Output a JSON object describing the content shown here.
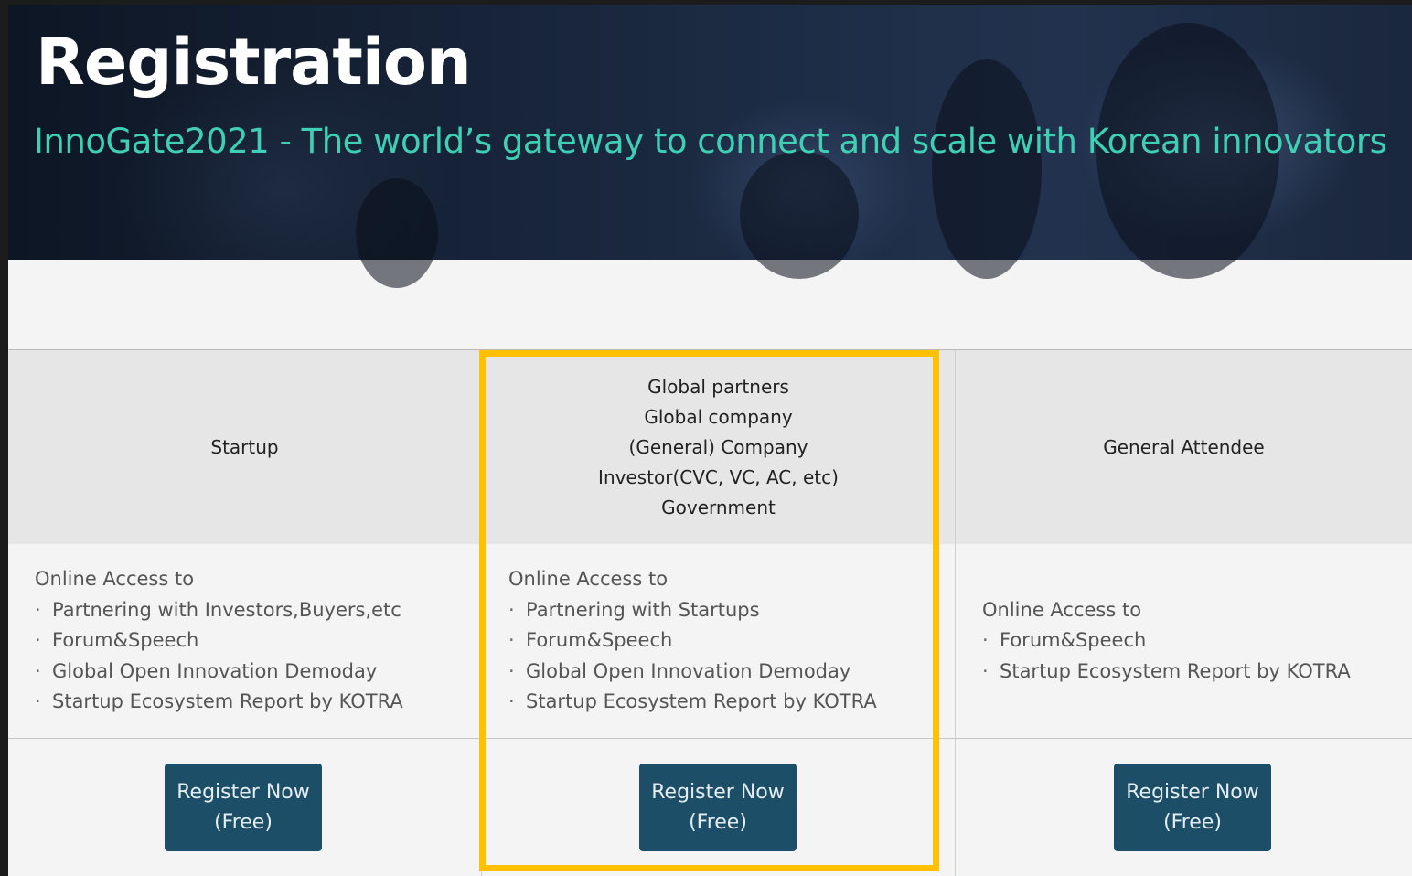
{
  "hero": {
    "title": "Registration",
    "subtitle": "InnoGate2021 - The world’s gateway to connect and scale with Korean innovators"
  },
  "colors": {
    "subtitle": "#3fcfb4",
    "button_bg": "#1d4e67",
    "highlight": "#ffc000"
  },
  "columns": [
    {
      "heading": [
        "Startup"
      ],
      "intro": "Online Access to",
      "items": [
        "Partnering with Investors,Buyers,etc",
        "Forum&Speech",
        "Global Open Innovation Demoday",
        "Startup Ecosystem Report by KOTRA"
      ],
      "button": [
        "Register Now",
        "(Free)"
      ]
    },
    {
      "heading": [
        "Global partners",
        "Global company",
        "(General) Company",
        "Investor(CVC, VC, AC, etc)",
        "Government"
      ],
      "intro": "Online Access to",
      "items": [
        "Partnering with Startups",
        "Forum&Speech",
        "Global Open Innovation Demoday",
        "Startup Ecosystem Report by KOTRA"
      ],
      "button": [
        "Register Now",
        "(Free)"
      ]
    },
    {
      "heading": [
        "General Attendee"
      ],
      "intro": "Online Access to",
      "items": [
        "Forum&Speech",
        "Startup Ecosystem Report by KOTRA"
      ],
      "button": [
        "Register Now",
        "(Free)"
      ]
    }
  ]
}
